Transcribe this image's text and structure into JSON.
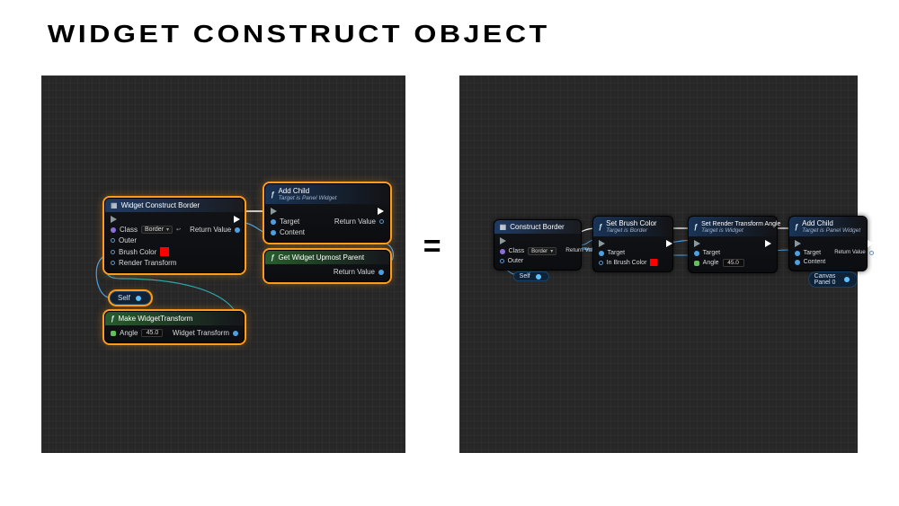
{
  "title": "WIDGET CONSTRUCT OBJECT",
  "equals": "=",
  "left": {
    "wcb": {
      "title": "Widget Construct Border",
      "class_label": "Class",
      "class_value": "Border",
      "outer_label": "Outer",
      "brush_color_label": "Brush Color",
      "render_transform_label": "Render Transform",
      "return_label": "Return Value"
    },
    "addchild": {
      "title": "Add Child",
      "subtitle": "Target is Panel Widget",
      "target_label": "Target",
      "content_label": "Content",
      "return_label": "Return Value"
    },
    "upmost": {
      "title": "Get Widget Upmost Parent",
      "return_label": "Return Value"
    },
    "self": {
      "label": "Self"
    },
    "mwt": {
      "title": "Make WidgetTransform",
      "angle_label": "Angle",
      "angle_value": "45.0",
      "out_label": "Widget Transform"
    }
  },
  "right": {
    "cb": {
      "title": "Construct Border",
      "class_label": "Class",
      "class_value": "Border",
      "outer_label": "Outer",
      "return_label": "Return Value"
    },
    "sbc": {
      "title": "Set Brush Color",
      "subtitle": "Target is Border",
      "target_label": "Target",
      "in_label": "In Brush Color"
    },
    "srta": {
      "title": "Set Render Transform Angle",
      "subtitle": "Target is Widget",
      "target_label": "Target",
      "angle_label": "Angle",
      "angle_value": "45.0"
    },
    "addchild": {
      "title": "Add Child",
      "subtitle": "Target is Panel Widget",
      "target_label": "Target",
      "content_label": "Content",
      "return_label": "Return Value"
    },
    "self": {
      "label": "Self"
    },
    "canvas_panel": {
      "label": "Canvas Panel 0"
    }
  }
}
